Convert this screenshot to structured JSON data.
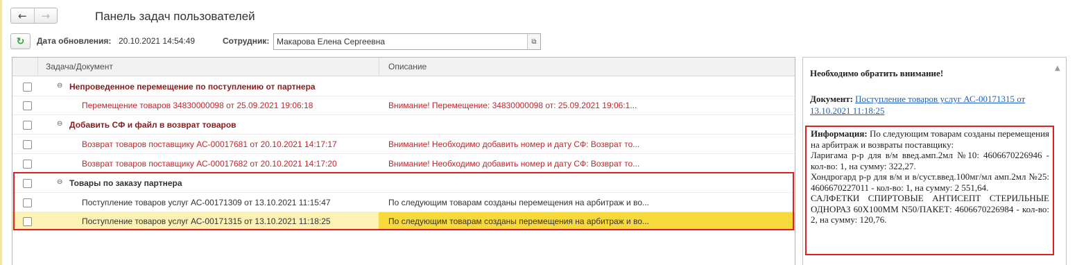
{
  "window": {
    "title": "Панель задач пользователей",
    "nav": {
      "back_icon": "←",
      "forward_icon": "→"
    }
  },
  "toolbar": {
    "refresh_icon": "↻",
    "update_date_label": "Дата обновления:",
    "update_date_value": "20.10.2021 14:54:49",
    "employee_label": "Сотрудник:",
    "employee_value": "Макарова Елена Сергеевна",
    "employee_open_icon": "⧉"
  },
  "table": {
    "columns": {
      "task": "Задача/Документ",
      "description": "Описание"
    },
    "group_toggle_icon": "⊖",
    "rows": [
      {
        "kind": "group",
        "text": "Непроведенное перемещение по поступлению от партнера"
      },
      {
        "kind": "item",
        "task": "Перемещение товаров 34830000098 от 25.09.2021 19:06:18",
        "description": "Внимание! Перемещение: 34830000098 от: 25.09.2021 19:06:1..."
      },
      {
        "kind": "group",
        "text": "Добавить СФ и файл в возврат товаров"
      },
      {
        "kind": "item",
        "task": "Возврат товаров поставщику АС-00017681 от 20.10.2021 14:17:17",
        "description": "Внимание! Необходимо добавить номер и дату СФ: Возврат то..."
      },
      {
        "kind": "item",
        "task": "Возврат товаров поставщику АС-00017682 от 20.10.2021 14:17:20",
        "description": "Внимание! Необходимо добавить номер и дату СФ: Возврат то..."
      },
      {
        "kind": "group",
        "text": "Товары по заказу партнера"
      },
      {
        "kind": "item",
        "task": "Поступление товаров услуг АС-00171309 от 13.10.2021 11:15:47",
        "description": "По следующим товарам созданы перемещения на арбитраж и во..."
      },
      {
        "kind": "item",
        "task": "Поступление товаров услуг АС-00171315 от 13.10.2021 11:18:25",
        "description": "По следующим товарам созданы перемещения на арбитраж и во..."
      }
    ]
  },
  "details": {
    "heading": "Необходимо обратить внимание!",
    "document_label": "Документ:",
    "document_link": "Поступление товаров услуг АС-00171315 от 13.10.2021 11:18:25",
    "info_label": "Информация:",
    "info_intro": "По следующим товарам созданы перемещения на арбитраж и возвраты поставщику:",
    "info_items": [
      "Ларигама р-р для в/м введ.амп.2мл №10: 4606670226946 - кол-во: 1, на сумму: 322,27.",
      "Хондрогард р-р для в/м и в/суст.введ.100мг/мл амп.2мл №25: 4606670227011 - кол-во: 1, на сумму: 2 551,64.",
      "САЛФЕТКИ СПИРТОВЫЕ АНТИСЕПТ СТЕРИЛЬНЫЕ ОДНОРАЗ 60Х100ММ N50/ПАКЕТ: 4606670226984 - кол-во: 2, на сумму: 120,76."
    ],
    "scroll_up_icon": "▲"
  },
  "colors": {
    "selected_row": "#fbf2b4",
    "selected_cell": "#f8d93b",
    "warning_text": "#c0272d",
    "group_text": "#8b1a1a",
    "highlight_border": "#e02020",
    "link": "#1f5fbf"
  }
}
